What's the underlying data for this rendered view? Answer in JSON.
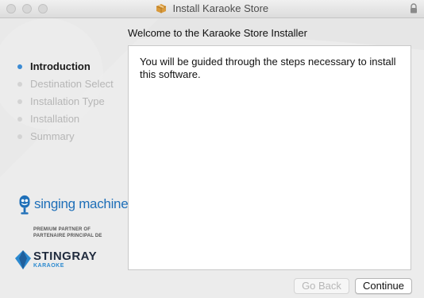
{
  "window": {
    "title": "Install Karaoke Store"
  },
  "content": {
    "heading": "Welcome to the Karaoke Store Installer",
    "body": "You will be guided through the steps necessary to install this software."
  },
  "steps": [
    {
      "label": "Introduction",
      "active": true
    },
    {
      "label": "Destination Select",
      "active": false
    },
    {
      "label": "Installation Type",
      "active": false
    },
    {
      "label": "Installation",
      "active": false
    },
    {
      "label": "Summary",
      "active": false
    }
  ],
  "branding": {
    "singing_machine": "singing machine",
    "singing_machine_tm": "®",
    "partner_line1": "PREMIUM PARTNER OF",
    "partner_line2": "PARTENAIRE PRINCIPAL DE",
    "stingray": "STINGRAY",
    "stingray_sub": "KARAOKE"
  },
  "buttons": {
    "back": "Go Back",
    "continue": "Continue"
  },
  "icons": {
    "title": "package-icon",
    "lock": "lock-icon"
  },
  "colors": {
    "active_step_dot": "#3b8bd4",
    "brand_blue": "#1e6fb8"
  }
}
